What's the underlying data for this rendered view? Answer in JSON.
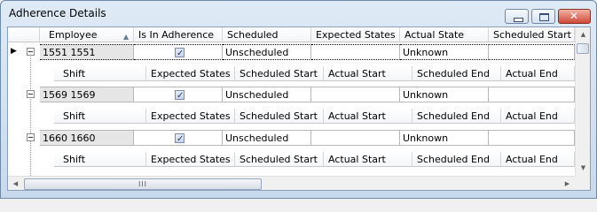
{
  "window": {
    "title": "Adherence Details",
    "controls": {
      "minimize": "minimize",
      "maximize": "maximize",
      "close": "close"
    }
  },
  "grid": {
    "columns": [
      "Employee",
      "Is In Adherence",
      "Scheduled",
      "Expected States",
      "Actual State",
      "Scheduled Start"
    ],
    "child_columns": [
      "Shift",
      "Expected States",
      "Scheduled Start",
      "Actual Start",
      "Scheduled End",
      "Actual End"
    ],
    "rows": [
      {
        "employee": "1551 1551",
        "in_adherence": true,
        "scheduled": "Unscheduled",
        "expected_states": "",
        "actual_state": "Unknown",
        "scheduled_start": ""
      },
      {
        "employee": "1569 1569",
        "in_adherence": true,
        "scheduled": "Unscheduled",
        "expected_states": "",
        "actual_state": "Unknown",
        "scheduled_start": ""
      },
      {
        "employee": "1660 1660",
        "in_adherence": true,
        "scheduled": "Unscheduled",
        "expected_states": "",
        "actual_state": "Unknown",
        "scheduled_start": ""
      }
    ]
  },
  "scrollbar": {
    "hthumb_grip": "III"
  }
}
